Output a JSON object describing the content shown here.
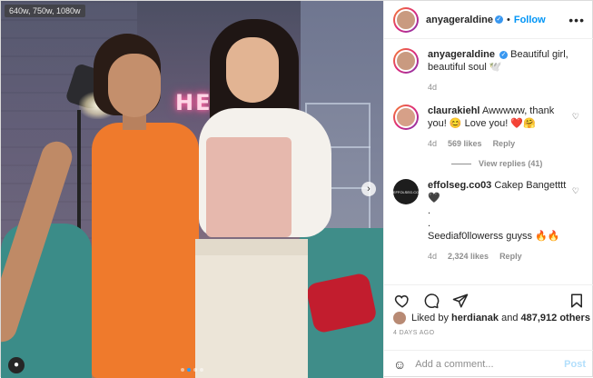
{
  "photo": {
    "size_badge": "640w, 750w, 1080w",
    "neon_text": "HELLO",
    "carousel_dots": 4,
    "active_dot": 2
  },
  "header": {
    "username": "anyageraldine",
    "separator": "•",
    "follow_label": "Follow",
    "more_icon": "more-horizontal-icon"
  },
  "caption": {
    "username": "anyageraldine",
    "text": "Beautiful girl, beautiful soul 🕊️",
    "time": "4d"
  },
  "comments": [
    {
      "username": "claurakiehl",
      "text": "Awwwww, thank you! 😊 Love you! ❤️🤗",
      "time": "4d",
      "likes": "569 likes",
      "reply": "Reply",
      "view_replies": "View replies (41)"
    },
    {
      "username": "effolseg.co03",
      "text": "Cakep Bangetttt 🖤",
      "line2": ".",
      "line3": ".",
      "line4": "Seediaf0llowerss guyss 🔥🔥",
      "time": "4d",
      "likes": "2,324 likes",
      "reply": "Reply",
      "avatar_text": "EFFOLSEG.CO"
    }
  ],
  "likes": {
    "prefix": "Liked by",
    "user": "herdianak",
    "and": "and",
    "count": "487,912 others"
  },
  "date": "4 DAYS AGO",
  "add_comment": {
    "placeholder": "Add a comment...",
    "post_label": "Post"
  },
  "colors": {
    "accent": "#0095f6",
    "verified": "#3897f0"
  }
}
